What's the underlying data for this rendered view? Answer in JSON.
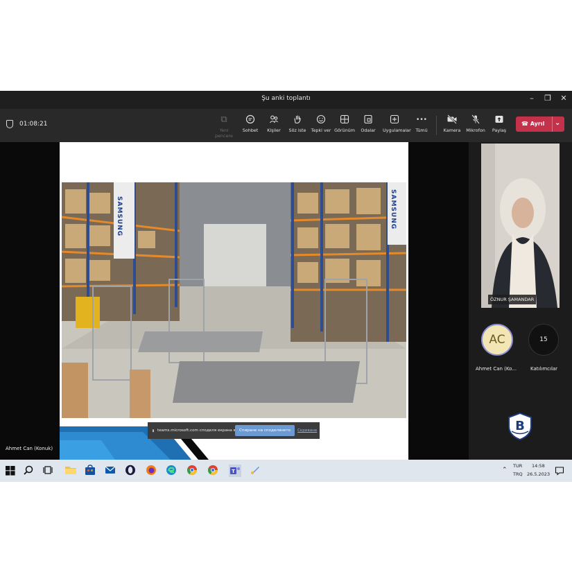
{
  "window": {
    "title": "Şu anki toplantı",
    "controls": [
      "–",
      "❐",
      "✕"
    ]
  },
  "toolbar": {
    "timer": "01:08:21",
    "buttons": [
      {
        "label": "Yeni pencere",
        "icon": "new-window-icon",
        "glyph": "⧉"
      },
      {
        "label": "Sohbet",
        "icon": "chat-icon",
        "glyph": "💬"
      },
      {
        "label": "Kişiler",
        "icon": "people-icon",
        "glyph": "👥"
      },
      {
        "label": "Söz iste",
        "icon": "raise-hand-icon",
        "glyph": "✋"
      },
      {
        "label": "Tepki ver",
        "icon": "smiley-icon",
        "glyph": "☺"
      },
      {
        "label": "Görünüm",
        "icon": "grid-view-icon",
        "glyph": "⊞"
      },
      {
        "label": "Odalar",
        "icon": "rooms-icon",
        "glyph": "▣"
      },
      {
        "label": "Uygulamalar",
        "icon": "apps-plus-icon",
        "glyph": "⊕"
      },
      {
        "label": "Tümü",
        "icon": "more-icon",
        "glyph": "•••"
      },
      {
        "label": "Kamera",
        "icon": "camera-off-icon",
        "glyph": "📷"
      },
      {
        "label": "Mikrofon",
        "icon": "mic-off-icon",
        "glyph": "🎙"
      },
      {
        "label": "Paylaş",
        "icon": "share-up-icon",
        "glyph": "⇧"
      }
    ],
    "leave_label": "Ayrıl",
    "leave_color": "#c4314b"
  },
  "stage": {
    "presenter_name": "Ahmet Can (Konuk)",
    "slide_brand": "SAMSUNG",
    "share_notice": "teams.microsoft.com споделя екрана ви.",
    "stop_sharing": "Спиране на споделянето",
    "hide": "Скриване"
  },
  "panel": {
    "video_name": "ÖZNUR ŞAMANDAR",
    "avatar_initials": "AC",
    "avatar_name": "Ahmet Can (Ko...",
    "participants_count": "15",
    "participants_label": "Katılımcılar"
  },
  "taskbar": {
    "lang": "TUR",
    "lang_sub": "TRQ",
    "time": "14:58",
    "date": "26.5.2023"
  }
}
